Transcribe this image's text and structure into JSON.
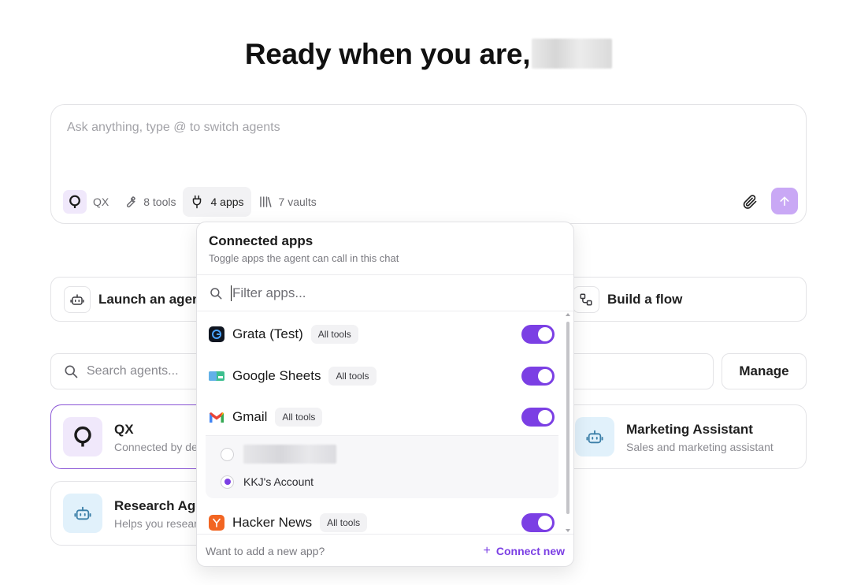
{
  "greeting": {
    "text": "Ready when you are,"
  },
  "composer": {
    "placeholder": "Ask anything, type @ to switch agents",
    "toolbar": {
      "agent": "QX",
      "tools": "8 tools",
      "apps": "4 apps",
      "vaults": "7 vaults"
    }
  },
  "actions": {
    "launch": "Launch an agent",
    "build": "Build a flow"
  },
  "agents_search": {
    "placeholder": "Search agents..."
  },
  "manage_label": "Manage",
  "agents": [
    {
      "name": "QX",
      "desc": "Connected by default"
    },
    {
      "name": "Marketing Assistant",
      "desc": "Sales and marketing assistant"
    },
    {
      "name": "Research Agent",
      "desc": "Helps you research"
    }
  ],
  "popover": {
    "title": "Connected apps",
    "subtitle": "Toggle apps the agent can call in this chat",
    "filter_placeholder": "Filter apps...",
    "apps": [
      {
        "name": "Grata (Test)",
        "tag": "All tools",
        "enabled": true,
        "icon": "grata-logo-icon"
      },
      {
        "name": "Google Sheets",
        "tag": "All tools",
        "enabled": true,
        "icon": "google-sheets-icon"
      },
      {
        "name": "Gmail",
        "tag": "All tools",
        "enabled": true,
        "icon": "gmail-icon"
      },
      {
        "name": "Hacker News",
        "tag": "All tools",
        "enabled": true,
        "icon": "hacker-news-icon"
      }
    ],
    "gmail_accounts": [
      {
        "label": "",
        "selected": false
      },
      {
        "label": "KKJ's Account",
        "selected": true
      }
    ],
    "footer_hint": "Want to add a new app?",
    "connect_label": "Connect new"
  },
  "colors": {
    "accent": "#7b3fe4",
    "send_button": "#c9a8f5",
    "agent_badge_bg": "#f0e8fb",
    "selected_card_border": "#8a55d6",
    "robot_bg": "#e1f1fb"
  }
}
